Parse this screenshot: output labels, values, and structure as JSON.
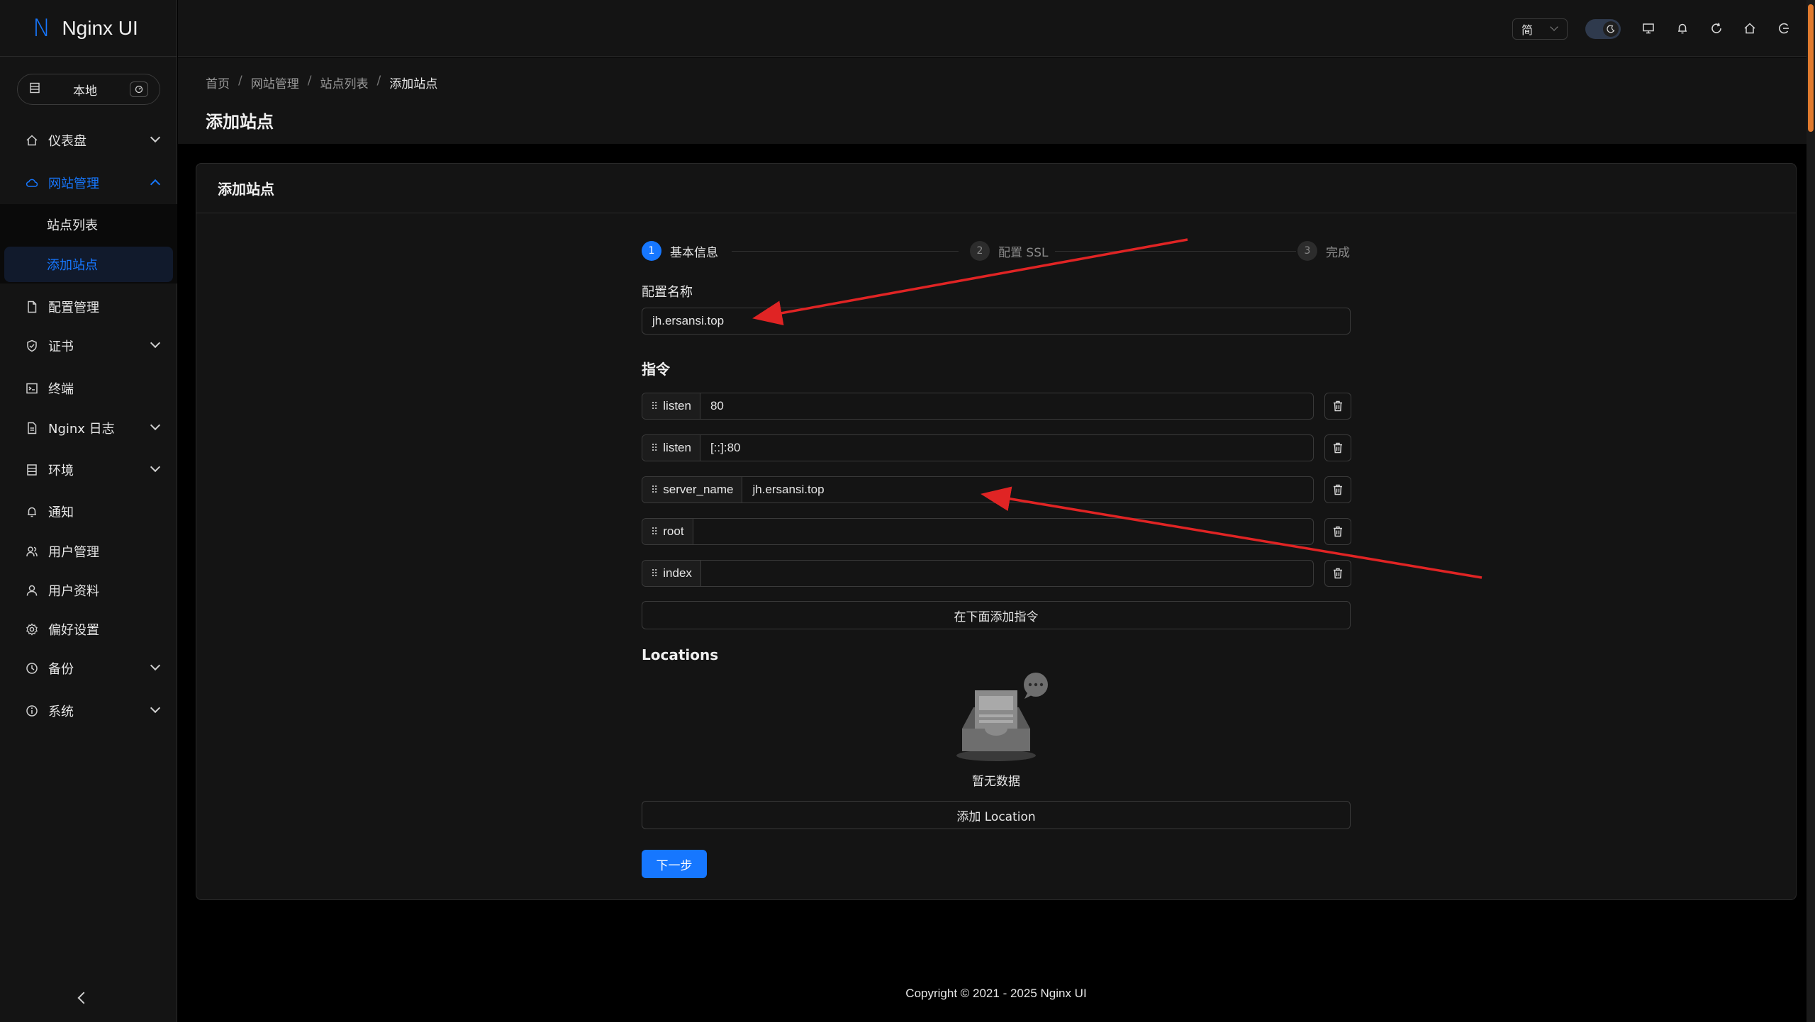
{
  "app": {
    "logo_letter": "N",
    "title": "Nginx UI"
  },
  "env_switch": {
    "label": "本地"
  },
  "sidebar": {
    "items": [
      {
        "label": "仪表盘"
      },
      {
        "label": "网站管理"
      },
      {
        "label": "配置管理"
      },
      {
        "label": "证书"
      },
      {
        "label": "终端"
      },
      {
        "label": "Nginx 日志"
      },
      {
        "label": "环境"
      },
      {
        "label": "通知"
      },
      {
        "label": "用户管理"
      },
      {
        "label": "用户资料"
      },
      {
        "label": "偏好设置"
      },
      {
        "label": "备份"
      },
      {
        "label": "系统"
      }
    ],
    "submenu": [
      {
        "label": "站点列表"
      },
      {
        "label": "添加站点"
      }
    ]
  },
  "header": {
    "language": "简"
  },
  "breadcrumb": {
    "items": [
      "首页",
      "网站管理",
      "站点列表",
      "添加站点"
    ]
  },
  "page_title": "添加站点",
  "card_title": "添加站点",
  "steps": [
    {
      "num": "1",
      "label": "基本信息"
    },
    {
      "num": "2",
      "label": "配置 SSL"
    },
    {
      "num": "3",
      "label": "完成"
    }
  ],
  "form": {
    "config_name_label": "配置名称",
    "config_name_value": "jh.ersansi.top",
    "directives_title": "指令",
    "directives": [
      {
        "key": "listen",
        "value": "80"
      },
      {
        "key": "listen",
        "value": "[::]:80"
      },
      {
        "key": "server_name",
        "value": "jh.ersansi.top"
      },
      {
        "key": "root",
        "value": ""
      },
      {
        "key": "index",
        "value": ""
      }
    ],
    "add_directive_label": "在下面添加指令",
    "locations_title": "Locations",
    "empty_text": "暂无数据",
    "add_location_label": "添加 Location",
    "next_label": "下一步"
  },
  "footer": "Copyright © 2021 - 2025 Nginx UI",
  "colors": {
    "primary": "#1677ff",
    "annotation": "#e02424"
  }
}
